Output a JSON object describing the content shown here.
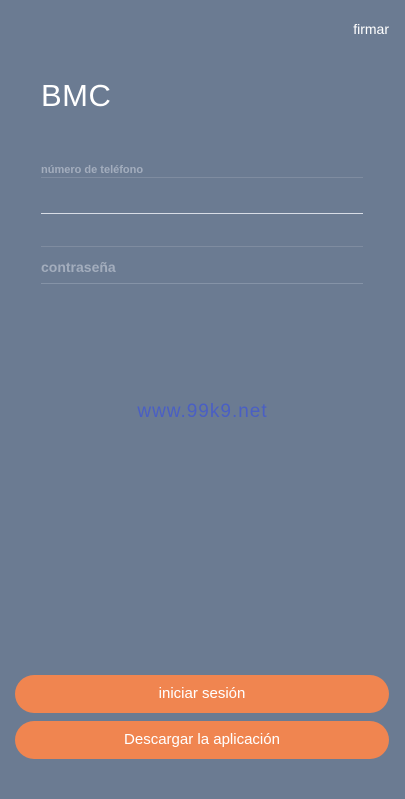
{
  "header": {
    "sign_label": "firmar",
    "app_title": "BMC"
  },
  "form": {
    "phone_label": "número de teléfono",
    "phone_value": "",
    "password_placeholder": "contraseña",
    "password_value": ""
  },
  "watermark": "www.99k9.net",
  "buttons": {
    "login_label": "iniciar sesión",
    "download_label": "Descargar la aplicación"
  },
  "colors": {
    "background": "#6b7b92",
    "button": "#f08550",
    "watermark": "#4a5fc4"
  }
}
